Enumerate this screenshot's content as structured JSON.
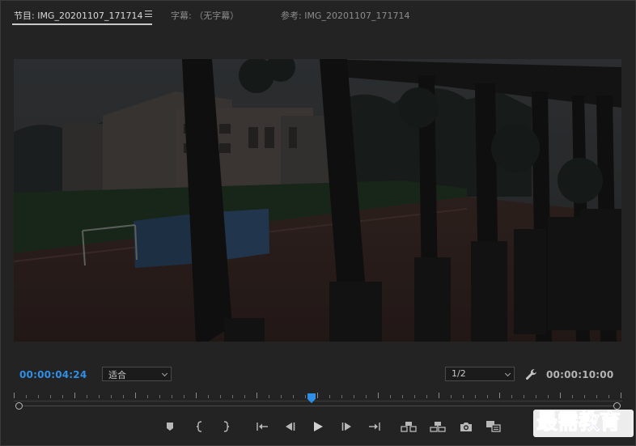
{
  "tabs": [
    {
      "label": "节目: IMG_20201107_171714",
      "active": true
    },
    {
      "label": "字幕: （无字幕）",
      "active": false
    },
    {
      "label": "参考: IMG_20201107_171714",
      "active": false
    }
  ],
  "icons": {
    "menu": "hamburger-menu-icon",
    "wrench": "wrench-icon",
    "transport": [
      "add-marker-icon",
      "mark-in-icon",
      "mark-out-icon",
      "go-to-in-icon",
      "step-back-icon",
      "play-icon",
      "step-forward-icon",
      "go-to-out-icon",
      "lift-icon",
      "extract-icon",
      "export-frame-icon",
      "compare-icon"
    ]
  },
  "monitor": {
    "playhead_timecode": "00:00:04:24",
    "duration_timecode": "00:00:10:00",
    "zoom_select": "适合",
    "resolution_select": "1/2",
    "playhead_fraction": 0.49
  },
  "colors": {
    "accent": "#2f8fe6",
    "panel_bg": "#232323"
  },
  "watermark": {
    "text": "最需教育"
  }
}
